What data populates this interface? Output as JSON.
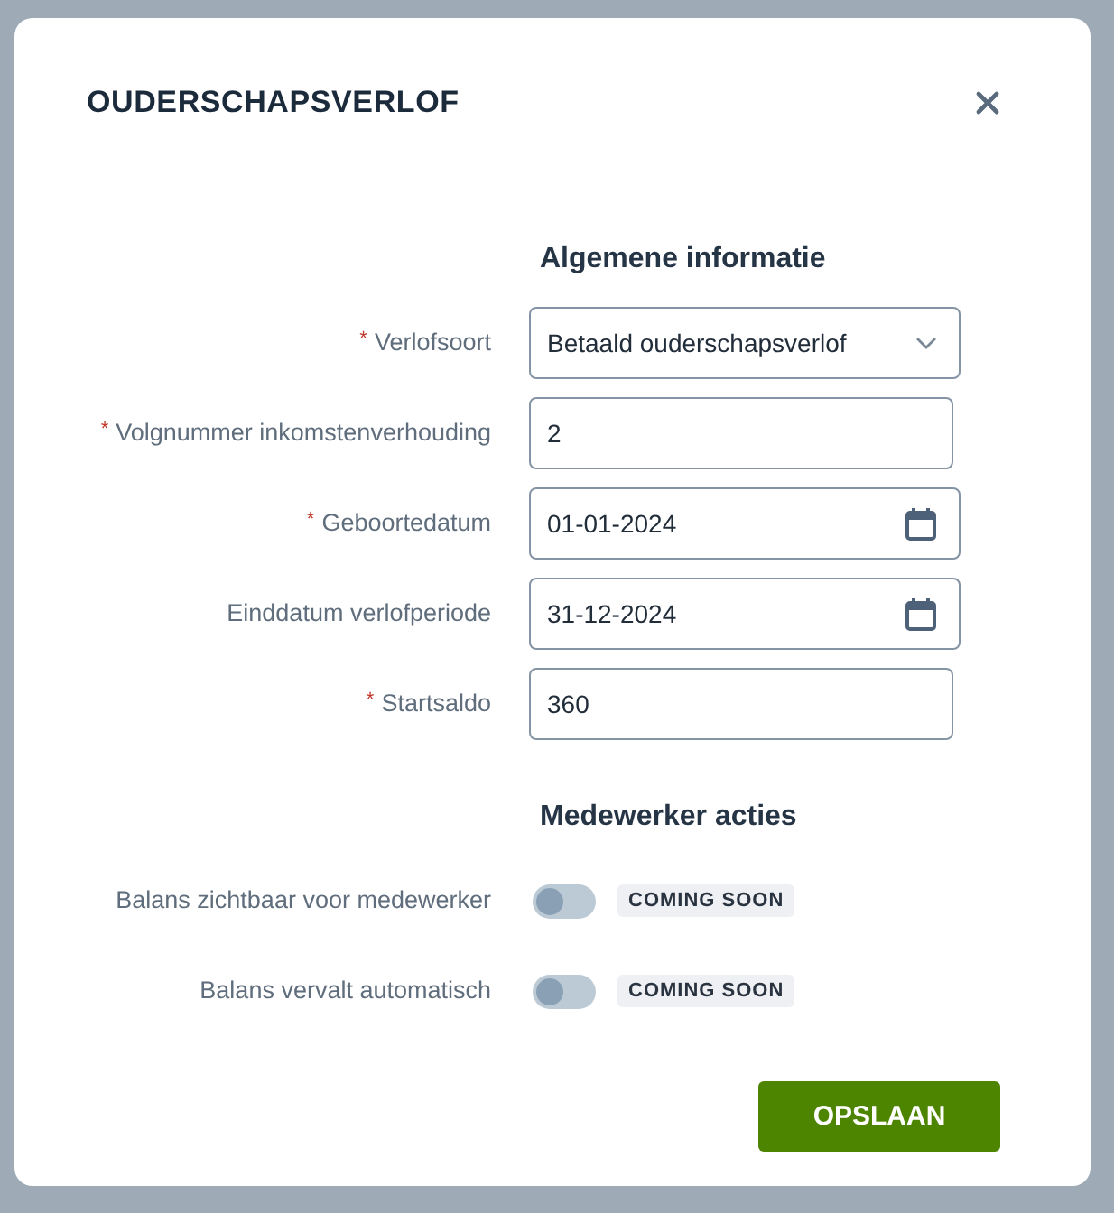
{
  "dialog": {
    "title": "OUDERSCHAPSVERLOF",
    "sections": [
      {
        "heading": "Algemene informatie",
        "fields": [
          {
            "kind": "select",
            "label": "Verlofsoort",
            "required_mark": "*",
            "value": "Betaald ouderschapsverlof"
          },
          {
            "kind": "text",
            "label": "Volgnummer inkomstenverhouding",
            "required_mark": "*",
            "value": "2"
          },
          {
            "kind": "date",
            "label": "Geboortedatum",
            "required_mark": "*",
            "value": "01-01-2024"
          },
          {
            "kind": "date",
            "label": "Einddatum verlofperiode",
            "value": "31-12-2024"
          },
          {
            "kind": "text",
            "label": "Startsaldo",
            "required_mark": "*",
            "value": "360"
          }
        ]
      },
      {
        "heading": "Medewerker acties",
        "fields": [
          {
            "kind": "toggle",
            "label": "Balans zichtbaar voor medewerker",
            "on": false,
            "badge": "COMING SOON"
          },
          {
            "kind": "toggle",
            "label": "Balans vervalt automatisch",
            "on": false,
            "badge": "COMING SOON"
          }
        ]
      }
    ],
    "save_button": "OPSLAAN"
  }
}
